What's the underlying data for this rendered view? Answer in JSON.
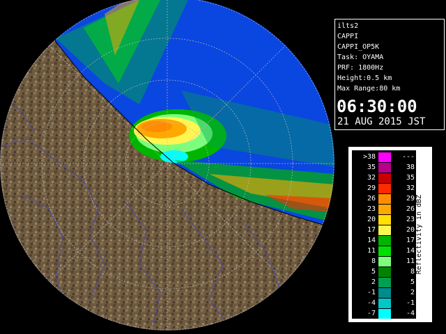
{
  "info": {
    "station": "ilts2",
    "product": "CAPPI",
    "product_code": "CAPPI_OP5K",
    "task": "Task: OYAMA",
    "prf": "PRF: 1800Hz",
    "height": "Height:0.5 km",
    "max_range": "Max Range:80 km",
    "time": "06:30:00",
    "date": "21 AUG 2015 JST"
  },
  "legend": {
    "title": "Reflectivity in dBZ",
    "rows": [
      {
        "min": ">38",
        "max": "---",
        "color": "#ff00ff"
      },
      {
        "min": "35",
        "max": "38",
        "color": "#b8008a"
      },
      {
        "min": "32",
        "max": "35",
        "color": "#c80000"
      },
      {
        "min": "29",
        "max": "32",
        "color": "#ff2a00"
      },
      {
        "min": "26",
        "max": "29",
        "color": "#ff8c00"
      },
      {
        "min": "23",
        "max": "26",
        "color": "#ffa800"
      },
      {
        "min": "20",
        "max": "23",
        "color": "#ffe000"
      },
      {
        "min": "17",
        "max": "20",
        "color": "#fff550"
      },
      {
        "min": "14",
        "max": "17",
        "color": "#00b400"
      },
      {
        "min": "11",
        "max": "14",
        "color": "#00e000"
      },
      {
        "min": "8",
        "max": "11",
        "color": "#7cff7c"
      },
      {
        "min": "5",
        "max": "8",
        "color": "#008400"
      },
      {
        "min": "2",
        "max": "5",
        "color": "#00a050"
      },
      {
        "min": "-1",
        "max": "2",
        "color": "#008c8c"
      },
      {
        "min": "-4",
        "max": "-1",
        "color": "#00c8c8"
      },
      {
        "min": "-7",
        "max": "-4",
        "color": "#00ffff"
      }
    ]
  },
  "colors": {
    "sea": "#0a46e0",
    "land": "#6e5a40",
    "background": "#000000"
  }
}
